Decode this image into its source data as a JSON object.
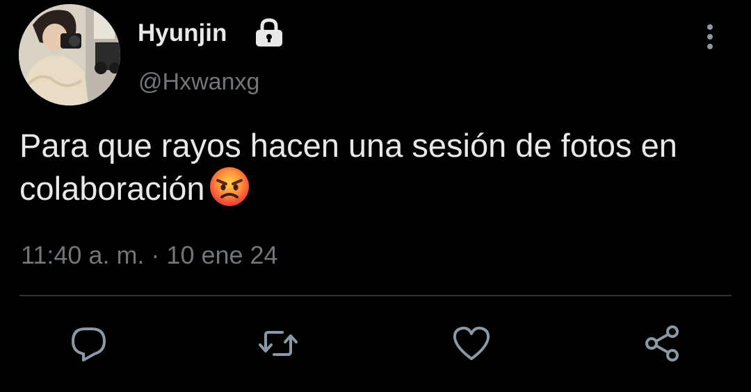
{
  "user": {
    "display_name": "Hyunjin",
    "handle": "@Hxwanxg",
    "protected_icon": "lock-icon",
    "avatar": "profile-photo-avatar"
  },
  "tweet": {
    "text": "Para que rayos hacen una sesión de fotos en colaboración",
    "emoji": "angry-face-emoji",
    "timestamp": "11:40 a. m. · 10 ene 24"
  },
  "actions": [
    {
      "name": "reply",
      "icon": "reply-icon"
    },
    {
      "name": "retweet",
      "icon": "retweet-icon"
    },
    {
      "name": "like",
      "icon": "heart-icon"
    },
    {
      "name": "share",
      "icon": "share-icon"
    }
  ],
  "menu_icon": "more-options-icon",
  "colors": {
    "background": "#000000",
    "primary_text": "#e7e9ea",
    "secondary_text": "#71767b",
    "icon_gray": "#8b98a5",
    "divider": "#2f3336"
  }
}
